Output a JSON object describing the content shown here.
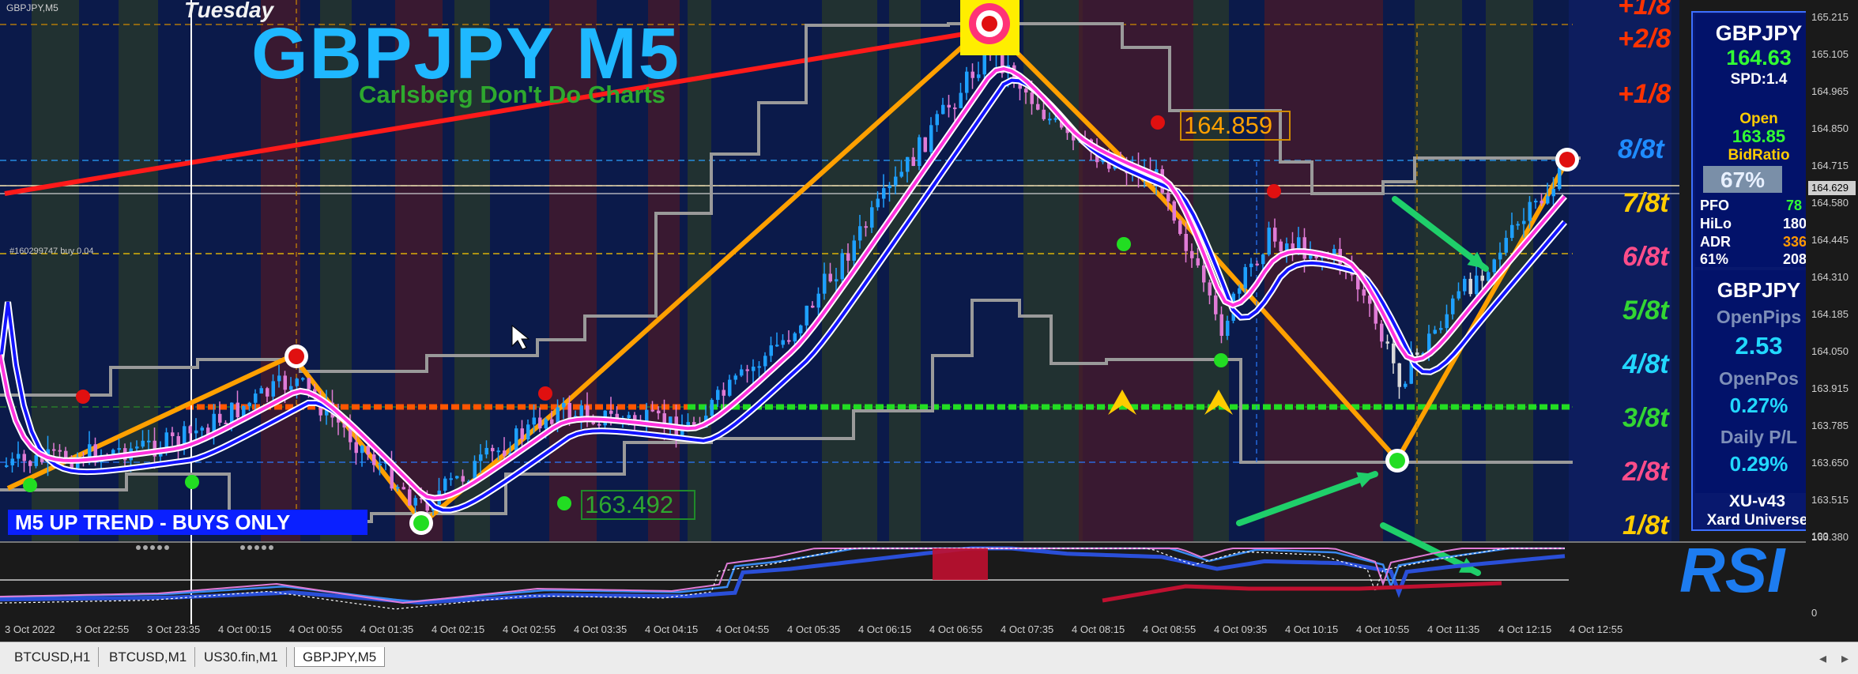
{
  "window": {
    "symbol_tag": "GBPJPY,M5"
  },
  "chart": {
    "day_label": "Tuesday",
    "title": "GBPJPY M5",
    "subtitle": "Carlsberg Don't Do Charts",
    "trend_banner": "M5 UP TREND - BUYS ONLY",
    "order_tag": "#160299747 buy 0.04",
    "level_labels": {
      "high": "164.859",
      "low": "163.492"
    },
    "fib_levels": [
      {
        "label": "+1/8",
        "color": "#ff3300"
      },
      {
        "label": "+2/8",
        "color": "#ff3300"
      },
      {
        "label": "+1/8",
        "color": "#ff3300"
      },
      {
        "label": "8/8t",
        "color": "#1f8cff"
      },
      {
        "label": "7/8t",
        "color": "#ffcc00"
      },
      {
        "label": "6/8t",
        "color": "#ff4d8a"
      },
      {
        "label": "5/8t",
        "color": "#33d633"
      },
      {
        "label": "4/8t",
        "color": "#22d8ff"
      },
      {
        "label": "3/8t",
        "color": "#33d633"
      },
      {
        "label": "2/8t",
        "color": "#ff4d8a"
      },
      {
        "label": "1/8t",
        "color": "#ffcc00"
      }
    ]
  },
  "info_panel": {
    "symbol": "GBPJPY",
    "price": "164.63",
    "spread": "SPD:1.4",
    "open_label": "Open",
    "open_value": "163.85",
    "bid_ratio_label": "BidRatio",
    "bid_ratio_value": "67%",
    "stats": [
      {
        "label": "PFO",
        "value": "78",
        "color": "#33ff33"
      },
      {
        "label": "HiLo",
        "value": "180",
        "color": "#ffffff"
      },
      {
        "label": "ADR",
        "value": "336",
        "color": "#ff9900"
      },
      {
        "label": "61%",
        "value": "208",
        "color": "#ffffff"
      }
    ],
    "symbol2": "GBPJPY",
    "open_pips_label": "OpenPips",
    "open_pips_value": "2.53",
    "open_pos_label": "OpenPos",
    "open_pos_value": "0.27%",
    "daily_pl_label": "Daily P/L",
    "daily_pl_value": "0.29%",
    "version": "XU-v43",
    "brand": "Xard Universe"
  },
  "rsi": {
    "label": "RSI",
    "scale": [
      "100",
      "0"
    ]
  },
  "price_axis": {
    "ticks": [
      "165.215",
      "165.105",
      "164.965",
      "164.850",
      "164.715",
      "164.580",
      "164.445",
      "164.310",
      "164.185",
      "164.050",
      "163.915",
      "163.785",
      "163.650",
      "163.515",
      "163.380"
    ],
    "current": "164.629"
  },
  "time_axis": [
    "3 Oct 2022",
    "3 Oct 22:55",
    "3 Oct 23:35",
    "4 Oct 00:15",
    "4 Oct 00:55",
    "4 Oct 01:35",
    "4 Oct 02:15",
    "4 Oct 02:55",
    "4 Oct 03:35",
    "4 Oct 04:15",
    "4 Oct 04:55",
    "4 Oct 05:35",
    "4 Oct 06:15",
    "4 Oct 06:55",
    "4 Oct 07:35",
    "4 Oct 08:15",
    "4 Oct 08:55",
    "4 Oct 09:35",
    "4 Oct 10:15",
    "4 Oct 10:55",
    "4 Oct 11:35",
    "4 Oct 12:15",
    "4 Oct 12:55"
  ],
  "tabs": [
    {
      "label": "BTCUSD,H1",
      "active": false
    },
    {
      "label": "BTCUSD,M1",
      "active": false
    },
    {
      "label": "US30.fin,M1",
      "active": false
    },
    {
      "label": "GBPJPY,M5",
      "active": true
    }
  ],
  "colors": {
    "bg": "#0b1a4a",
    "bull": "#1ea0ff",
    "bear": "#e07bd6",
    "zigzag": "#ffa000",
    "trendline": "#ff1a1a",
    "ma_fast": "#ff33dd",
    "ma_slow": "#1414ff",
    "envelope": "#9a9a9a"
  }
}
